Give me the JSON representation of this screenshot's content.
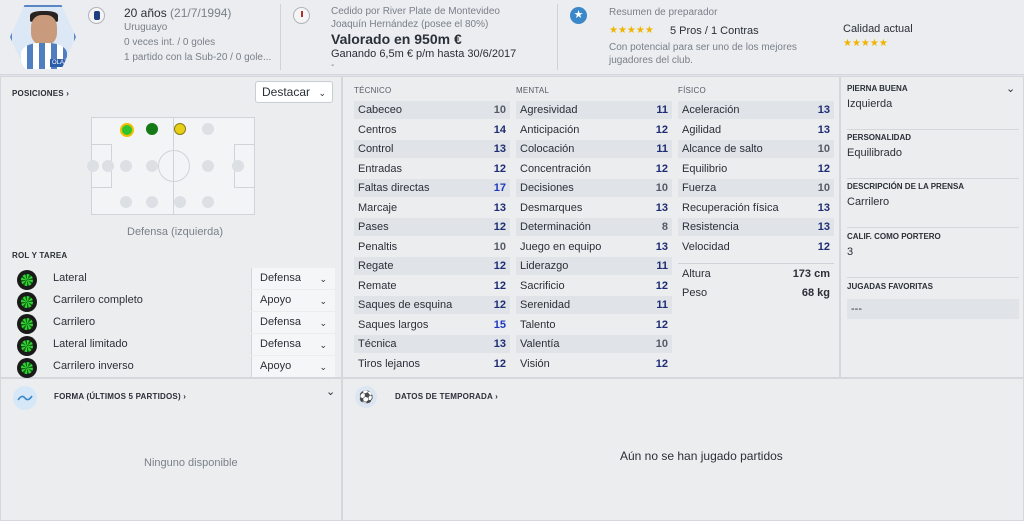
{
  "header": {
    "player_tag": "OLAZA",
    "age": "20 años",
    "birth": "(21/7/1994)",
    "nationality": "Uruguayo",
    "caps": "0 veces int. / 0 goles",
    "youth": "1 partido con la Sub-20 / 0 gole...",
    "loan_line1": "Cedido por River Plate de Montevideo",
    "loan_line2": "Joaquín Hernández (posee el 80%)",
    "value": "Valorado en 950m €",
    "wage": "Ganando 6,5m € p/m hasta 30/6/2017",
    "dash": "-",
    "coach_title": "Resumen de preparador",
    "pros_cons": "5 Pros / 1 Contras",
    "coach_note1": "Con potencial para ser uno de los mejores",
    "coach_note2": "jugadores del club.",
    "quality_label": "Calidad actual",
    "quality_stars": "★★★★★",
    "potential_stars": "★★★★★"
  },
  "positions": {
    "title": "POSICIONES ›",
    "highlight": "Destacar",
    "position_name": "Defensa (izquierda)"
  },
  "roles": {
    "title": "ROL Y TAREA",
    "items": [
      {
        "name": "Lateral",
        "duty": "Defensa"
      },
      {
        "name": "Carrilero completo",
        "duty": "Apoyo"
      },
      {
        "name": "Carrilero",
        "duty": "Defensa"
      },
      {
        "name": "Lateral limitado",
        "duty": "Defensa"
      },
      {
        "name": "Carrilero inverso",
        "duty": "Apoyo"
      }
    ]
  },
  "attributes": {
    "tecnico_title": "TÉCNICO",
    "mental_title": "MENTAL",
    "fisico_title": "FÍSICO",
    "tecnico": [
      {
        "n": "Cabeceo",
        "v": "10"
      },
      {
        "n": "Centros",
        "v": "14"
      },
      {
        "n": "Control",
        "v": "13"
      },
      {
        "n": "Entradas",
        "v": "12"
      },
      {
        "n": "Faltas directas",
        "v": "17"
      },
      {
        "n": "Marcaje",
        "v": "13"
      },
      {
        "n": "Pases",
        "v": "12"
      },
      {
        "n": "Penaltis",
        "v": "10"
      },
      {
        "n": "Regate",
        "v": "12"
      },
      {
        "n": "Remate",
        "v": "12"
      },
      {
        "n": "Saques de esquina",
        "v": "12"
      },
      {
        "n": "Saques largos",
        "v": "15"
      },
      {
        "n": "Técnica",
        "v": "13"
      },
      {
        "n": "Tiros lejanos",
        "v": "12"
      }
    ],
    "mental": [
      {
        "n": "Agresividad",
        "v": "11"
      },
      {
        "n": "Anticipación",
        "v": "12"
      },
      {
        "n": "Colocación",
        "v": "11"
      },
      {
        "n": "Concentración",
        "v": "12"
      },
      {
        "n": "Decisiones",
        "v": "10"
      },
      {
        "n": "Desmarques",
        "v": "13"
      },
      {
        "n": "Determinación",
        "v": "8"
      },
      {
        "n": "Juego en equipo",
        "v": "13"
      },
      {
        "n": "Liderazgo",
        "v": "11"
      },
      {
        "n": "Sacrificio",
        "v": "12"
      },
      {
        "n": "Serenidad",
        "v": "11"
      },
      {
        "n": "Talento",
        "v": "12"
      },
      {
        "n": "Valentía",
        "v": "10"
      },
      {
        "n": "Visión",
        "v": "12"
      }
    ],
    "fisico": [
      {
        "n": "Aceleración",
        "v": "13"
      },
      {
        "n": "Agilidad",
        "v": "13"
      },
      {
        "n": "Alcance de salto",
        "v": "10"
      },
      {
        "n": "Equilibrio",
        "v": "12"
      },
      {
        "n": "Fuerza",
        "v": "10"
      },
      {
        "n": "Recuperación física",
        "v": "13"
      },
      {
        "n": "Resistencia",
        "v": "13"
      },
      {
        "n": "Velocidad",
        "v": "12"
      }
    ],
    "height_label": "Altura",
    "height": "173 cm",
    "weight_label": "Peso",
    "weight": "68 kg"
  },
  "info": {
    "foot_label": "PIERNA BUENA",
    "foot": "Izquierda",
    "personality_label": "PERSONALIDAD",
    "personality": "Equilibrado",
    "press_label": "DESCRIPCIÓN DE LA PRENSA",
    "press": "Carrilero",
    "gk_label": "CALIF. COMO PORTERO",
    "gk": "3",
    "moves_label": "JUGADAS FAVORITAS",
    "moves": "---"
  },
  "form": {
    "title": "FORMA (ÚLTIMOS 5 PARTIDOS) ›",
    "empty": "Ninguno disponible"
  },
  "season": {
    "title": "DATOS DE TEMPORADA ›",
    "empty": "Aún no se han jugado partidos"
  }
}
